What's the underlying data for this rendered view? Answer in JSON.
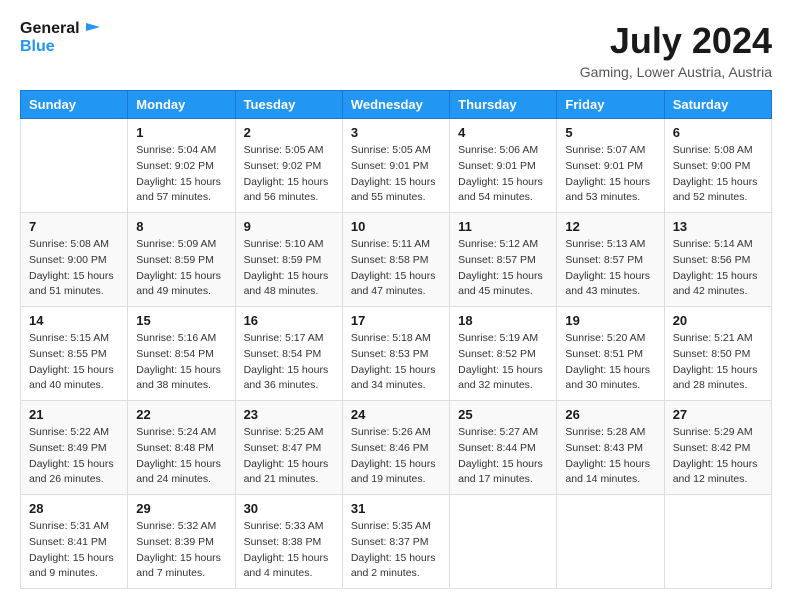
{
  "header": {
    "logo_line1": "General",
    "logo_line2": "Blue",
    "month_year": "July 2024",
    "location": "Gaming, Lower Austria, Austria"
  },
  "weekdays": [
    "Sunday",
    "Monday",
    "Tuesday",
    "Wednesday",
    "Thursday",
    "Friday",
    "Saturday"
  ],
  "weeks": [
    [
      {
        "day": "",
        "sunrise": "",
        "sunset": "",
        "daylight": ""
      },
      {
        "day": "1",
        "sunrise": "Sunrise: 5:04 AM",
        "sunset": "Sunset: 9:02 PM",
        "daylight": "Daylight: 15 hours and 57 minutes."
      },
      {
        "day": "2",
        "sunrise": "Sunrise: 5:05 AM",
        "sunset": "Sunset: 9:02 PM",
        "daylight": "Daylight: 15 hours and 56 minutes."
      },
      {
        "day": "3",
        "sunrise": "Sunrise: 5:05 AM",
        "sunset": "Sunset: 9:01 PM",
        "daylight": "Daylight: 15 hours and 55 minutes."
      },
      {
        "day": "4",
        "sunrise": "Sunrise: 5:06 AM",
        "sunset": "Sunset: 9:01 PM",
        "daylight": "Daylight: 15 hours and 54 minutes."
      },
      {
        "day": "5",
        "sunrise": "Sunrise: 5:07 AM",
        "sunset": "Sunset: 9:01 PM",
        "daylight": "Daylight: 15 hours and 53 minutes."
      },
      {
        "day": "6",
        "sunrise": "Sunrise: 5:08 AM",
        "sunset": "Sunset: 9:00 PM",
        "daylight": "Daylight: 15 hours and 52 minutes."
      }
    ],
    [
      {
        "day": "7",
        "sunrise": "Sunrise: 5:08 AM",
        "sunset": "Sunset: 9:00 PM",
        "daylight": "Daylight: 15 hours and 51 minutes."
      },
      {
        "day": "8",
        "sunrise": "Sunrise: 5:09 AM",
        "sunset": "Sunset: 8:59 PM",
        "daylight": "Daylight: 15 hours and 49 minutes."
      },
      {
        "day": "9",
        "sunrise": "Sunrise: 5:10 AM",
        "sunset": "Sunset: 8:59 PM",
        "daylight": "Daylight: 15 hours and 48 minutes."
      },
      {
        "day": "10",
        "sunrise": "Sunrise: 5:11 AM",
        "sunset": "Sunset: 8:58 PM",
        "daylight": "Daylight: 15 hours and 47 minutes."
      },
      {
        "day": "11",
        "sunrise": "Sunrise: 5:12 AM",
        "sunset": "Sunset: 8:57 PM",
        "daylight": "Daylight: 15 hours and 45 minutes."
      },
      {
        "day": "12",
        "sunrise": "Sunrise: 5:13 AM",
        "sunset": "Sunset: 8:57 PM",
        "daylight": "Daylight: 15 hours and 43 minutes."
      },
      {
        "day": "13",
        "sunrise": "Sunrise: 5:14 AM",
        "sunset": "Sunset: 8:56 PM",
        "daylight": "Daylight: 15 hours and 42 minutes."
      }
    ],
    [
      {
        "day": "14",
        "sunrise": "Sunrise: 5:15 AM",
        "sunset": "Sunset: 8:55 PM",
        "daylight": "Daylight: 15 hours and 40 minutes."
      },
      {
        "day": "15",
        "sunrise": "Sunrise: 5:16 AM",
        "sunset": "Sunset: 8:54 PM",
        "daylight": "Daylight: 15 hours and 38 minutes."
      },
      {
        "day": "16",
        "sunrise": "Sunrise: 5:17 AM",
        "sunset": "Sunset: 8:54 PM",
        "daylight": "Daylight: 15 hours and 36 minutes."
      },
      {
        "day": "17",
        "sunrise": "Sunrise: 5:18 AM",
        "sunset": "Sunset: 8:53 PM",
        "daylight": "Daylight: 15 hours and 34 minutes."
      },
      {
        "day": "18",
        "sunrise": "Sunrise: 5:19 AM",
        "sunset": "Sunset: 8:52 PM",
        "daylight": "Daylight: 15 hours and 32 minutes."
      },
      {
        "day": "19",
        "sunrise": "Sunrise: 5:20 AM",
        "sunset": "Sunset: 8:51 PM",
        "daylight": "Daylight: 15 hours and 30 minutes."
      },
      {
        "day": "20",
        "sunrise": "Sunrise: 5:21 AM",
        "sunset": "Sunset: 8:50 PM",
        "daylight": "Daylight: 15 hours and 28 minutes."
      }
    ],
    [
      {
        "day": "21",
        "sunrise": "Sunrise: 5:22 AM",
        "sunset": "Sunset: 8:49 PM",
        "daylight": "Daylight: 15 hours and 26 minutes."
      },
      {
        "day": "22",
        "sunrise": "Sunrise: 5:24 AM",
        "sunset": "Sunset: 8:48 PM",
        "daylight": "Daylight: 15 hours and 24 minutes."
      },
      {
        "day": "23",
        "sunrise": "Sunrise: 5:25 AM",
        "sunset": "Sunset: 8:47 PM",
        "daylight": "Daylight: 15 hours and 21 minutes."
      },
      {
        "day": "24",
        "sunrise": "Sunrise: 5:26 AM",
        "sunset": "Sunset: 8:46 PM",
        "daylight": "Daylight: 15 hours and 19 minutes."
      },
      {
        "day": "25",
        "sunrise": "Sunrise: 5:27 AM",
        "sunset": "Sunset: 8:44 PM",
        "daylight": "Daylight: 15 hours and 17 minutes."
      },
      {
        "day": "26",
        "sunrise": "Sunrise: 5:28 AM",
        "sunset": "Sunset: 8:43 PM",
        "daylight": "Daylight: 15 hours and 14 minutes."
      },
      {
        "day": "27",
        "sunrise": "Sunrise: 5:29 AM",
        "sunset": "Sunset: 8:42 PM",
        "daylight": "Daylight: 15 hours and 12 minutes."
      }
    ],
    [
      {
        "day": "28",
        "sunrise": "Sunrise: 5:31 AM",
        "sunset": "Sunset: 8:41 PM",
        "daylight": "Daylight: 15 hours and 9 minutes."
      },
      {
        "day": "29",
        "sunrise": "Sunrise: 5:32 AM",
        "sunset": "Sunset: 8:39 PM",
        "daylight": "Daylight: 15 hours and 7 minutes."
      },
      {
        "day": "30",
        "sunrise": "Sunrise: 5:33 AM",
        "sunset": "Sunset: 8:38 PM",
        "daylight": "Daylight: 15 hours and 4 minutes."
      },
      {
        "day": "31",
        "sunrise": "Sunrise: 5:35 AM",
        "sunset": "Sunset: 8:37 PM",
        "daylight": "Daylight: 15 hours and 2 minutes."
      },
      {
        "day": "",
        "sunrise": "",
        "sunset": "",
        "daylight": ""
      },
      {
        "day": "",
        "sunrise": "",
        "sunset": "",
        "daylight": ""
      },
      {
        "day": "",
        "sunrise": "",
        "sunset": "",
        "daylight": ""
      }
    ]
  ]
}
